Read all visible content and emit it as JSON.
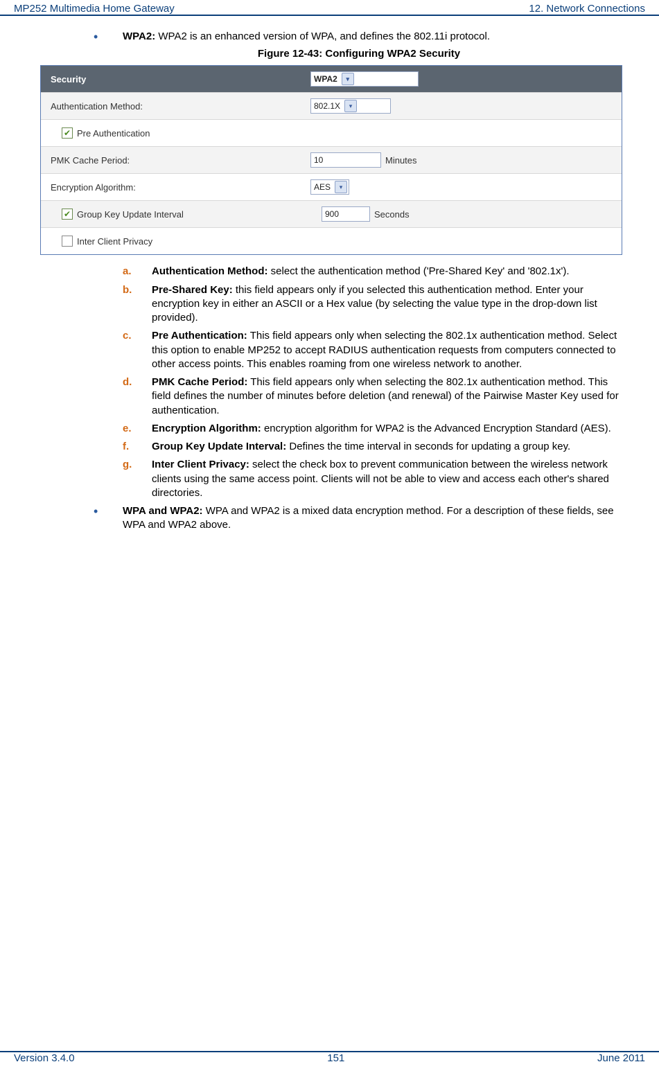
{
  "header": {
    "left": "MP252 Multimedia Home Gateway",
    "right": "12. Network Connections"
  },
  "footer": {
    "left": "Version 3.4.0",
    "center": "151",
    "right": "June 2011"
  },
  "intro_bullet": {
    "bold": "WPA2:",
    "text": " WPA2 is an enhanced version of WPA, and defines the 802.11i protocol."
  },
  "figure_caption": "Figure 12-43: Configuring WPA2 Security",
  "settings": {
    "security_label": "Security",
    "security_value": "WPA2",
    "auth_label": "Authentication Method:",
    "auth_value": "802.1X",
    "preauth_label": "Pre Authentication",
    "pmk_label": "PMK Cache Period:",
    "pmk_value": "10",
    "pmk_unit": "Minutes",
    "enc_label": "Encryption Algorithm:",
    "enc_value": "AES",
    "gk_label": "Group Key Update Interval",
    "gk_value": "900",
    "gk_unit": "Seconds",
    "icp_label": "Inter Client Privacy"
  },
  "items": {
    "a": {
      "letter": "a.",
      "bold": "Authentication Method:",
      "text": " select the authentication method ('Pre-Shared Key' and '802.1x')."
    },
    "b": {
      "letter": "b.",
      "bold": "Pre-Shared Key:",
      "text": " this field appears only if you selected this authentication method. Enter your encryption key in either an ASCII or a Hex value (by selecting the value type in the drop-down list provided)."
    },
    "c": {
      "letter": "c.",
      "bold": "Pre Authentication:",
      "text": " This field appears only when selecting the 802.1x authentication method. Select this option to enable MP252 to accept RADIUS authentication requests from computers connected to other access points. This enables roaming from one wireless network to another."
    },
    "d": {
      "letter": "d.",
      "bold": "PMK Cache Period:",
      "text": " This field appears only when selecting the 802.1x authentication method. This field defines the number of minutes before deletion (and renewal) of the Pairwise Master Key used for authentication."
    },
    "e": {
      "letter": "e.",
      "bold": "Encryption Algorithm:",
      "text": " encryption algorithm for WPA2 is the Advanced Encryption Standard (AES)."
    },
    "f": {
      "letter": "f.",
      "bold": "Group Key Update Interval:",
      "text": " Defines the time interval in seconds for updating a group key."
    },
    "g": {
      "letter": "g.",
      "bold": "Inter Client Privacy:",
      "text": " select the check box to prevent communication between the wireless network clients using the same access point. Clients will not be able to view and access each other's shared directories."
    }
  },
  "final_bullet": {
    "bold": "WPA and WPA2:",
    "text": " WPA and WPA2 is a mixed data encryption method. For a description of these fields, see WPA and WPA2 above."
  }
}
